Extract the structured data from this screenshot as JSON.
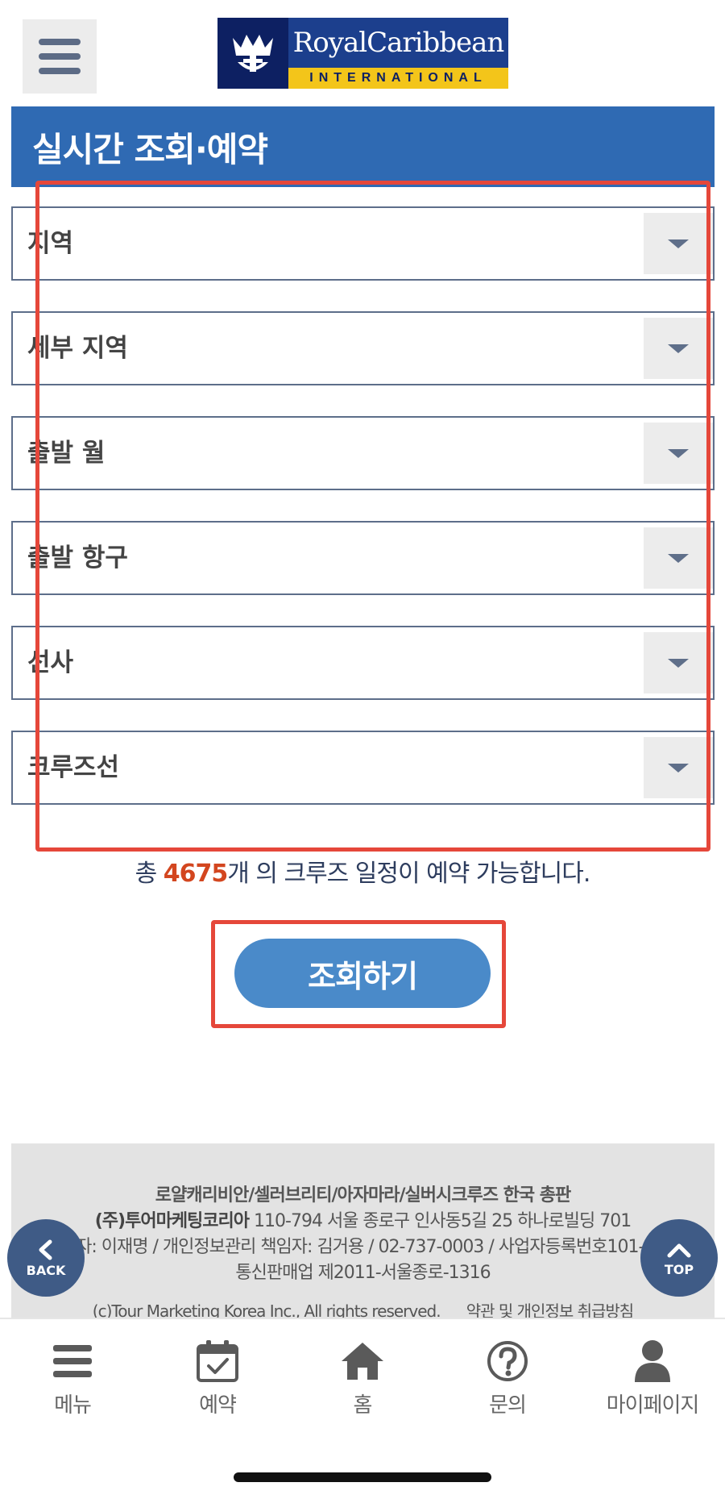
{
  "header": {
    "logo_name": "RoyalCaribbean",
    "logo_sub": "INTERNATIONAL",
    "brand_colors": {
      "navy": "#0d2062",
      "blue": "#1c3f8d",
      "gold": "#f3c51a"
    }
  },
  "title": "실시간 조회·예약",
  "filters": [
    {
      "label": "지역"
    },
    {
      "label": "세부 지역"
    },
    {
      "label": "출발 월"
    },
    {
      "label": "출발 항구"
    },
    {
      "label": "선사"
    },
    {
      "label": "크루즈선"
    }
  ],
  "count": {
    "prefix": "총 ",
    "number": "4675",
    "suffix": "개 의 크루즈 일정이 예약 가능합니다."
  },
  "search_button": "조회하기",
  "footer": {
    "line1": "로얄캐리비안/셀러브리티/아자마라/실버시크루즈 한국 총판",
    "company": "(주)투어마케팅코리아",
    "address": " 110-794 서울 종로구 인사동5길 25 하나로빌딩 701",
    "line3": "대표자: 이재명 / 개인정보관리 책임자: 김거용 / 02-737-0003 / 사업자등록번호101-86-0",
    "line4": "통신판매업 제2011-서울종로-1316",
    "copyright": "(c)Tour Marketing Korea Inc., All rights reserved.",
    "privacy_link": "약관 및 개인정보 취급방침"
  },
  "float": {
    "back": "BACK",
    "top": "TOP"
  },
  "nav": [
    {
      "label": "메뉴",
      "icon": "hamburger-icon"
    },
    {
      "label": "예약",
      "icon": "calendar-check-icon"
    },
    {
      "label": "홈",
      "icon": "home-icon"
    },
    {
      "label": "문의",
      "icon": "question-icon"
    },
    {
      "label": "마이페이지",
      "icon": "user-icon"
    }
  ],
  "colors": {
    "title_bar": "#2f6ab3",
    "button": "#4a8ac9",
    "count_number": "#d3461f",
    "annotation": "#e5473a"
  }
}
